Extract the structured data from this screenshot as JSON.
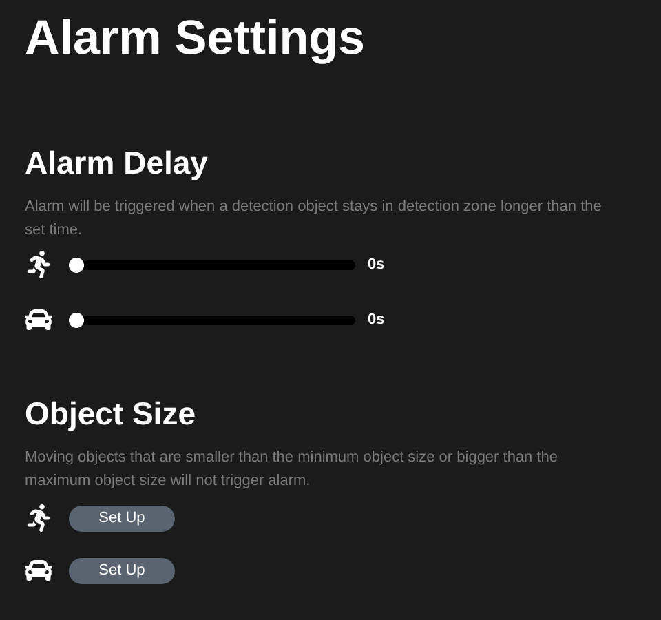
{
  "title": "Alarm Settings",
  "alarm_delay": {
    "heading": "Alarm Delay",
    "description": "Alarm will be triggered when a detection object stays in detection zone longer than the set time.",
    "sliders": [
      {
        "kind": "person",
        "level": 0,
        "reading": "0s"
      },
      {
        "kind": "vehicle",
        "level": 0,
        "reading": "0s"
      }
    ]
  },
  "object_size": {
    "heading": "Object Size",
    "description": "Moving objects that are smaller than the minimum object size or bigger than the maximum object size will not trigger alarm.",
    "rows": [
      {
        "kind": "person",
        "button": "Set Up"
      },
      {
        "kind": "vehicle",
        "button": "Set Up"
      }
    ]
  }
}
